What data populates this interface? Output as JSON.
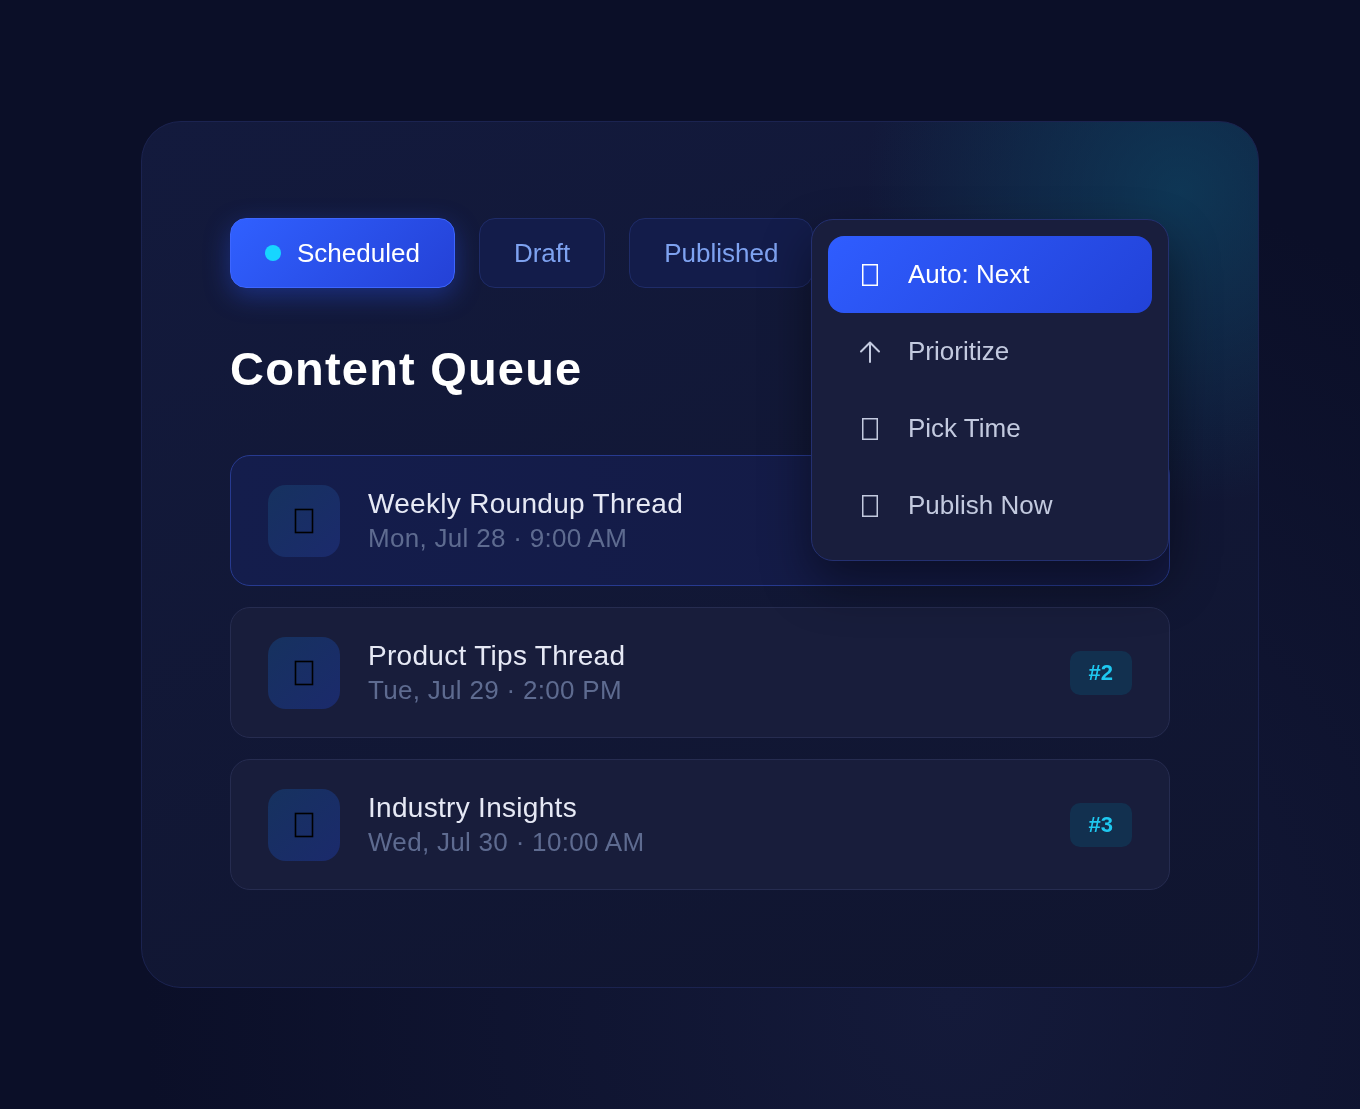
{
  "tabs": [
    {
      "label": "Scheduled",
      "selected": true
    },
    {
      "label": "Draft",
      "selected": false
    },
    {
      "label": "Published",
      "selected": false
    }
  ],
  "title": "Content Queue",
  "queue": [
    {
      "title": "Weekly Roundup Thread",
      "time": "Mon, Jul 28 · 9:00 AM",
      "selected": true
    },
    {
      "title": "Product Tips Thread",
      "time": "Tue, Jul 29 · 2:00 PM",
      "badge": "#2",
      "selected": false
    },
    {
      "title": "Industry Insights",
      "time": "Wed, Jul 30 · 10:00 AM",
      "badge": "#3",
      "selected": false
    }
  ],
  "menu": {
    "items": [
      {
        "label": "Auto: Next",
        "kind": "box",
        "selected": true
      },
      {
        "label": "Prioritize",
        "kind": "arrow",
        "selected": false
      },
      {
        "label": "Pick Time",
        "kind": "box",
        "selected": false
      },
      {
        "label": "Publish Now",
        "kind": "box",
        "selected": false
      }
    ]
  }
}
